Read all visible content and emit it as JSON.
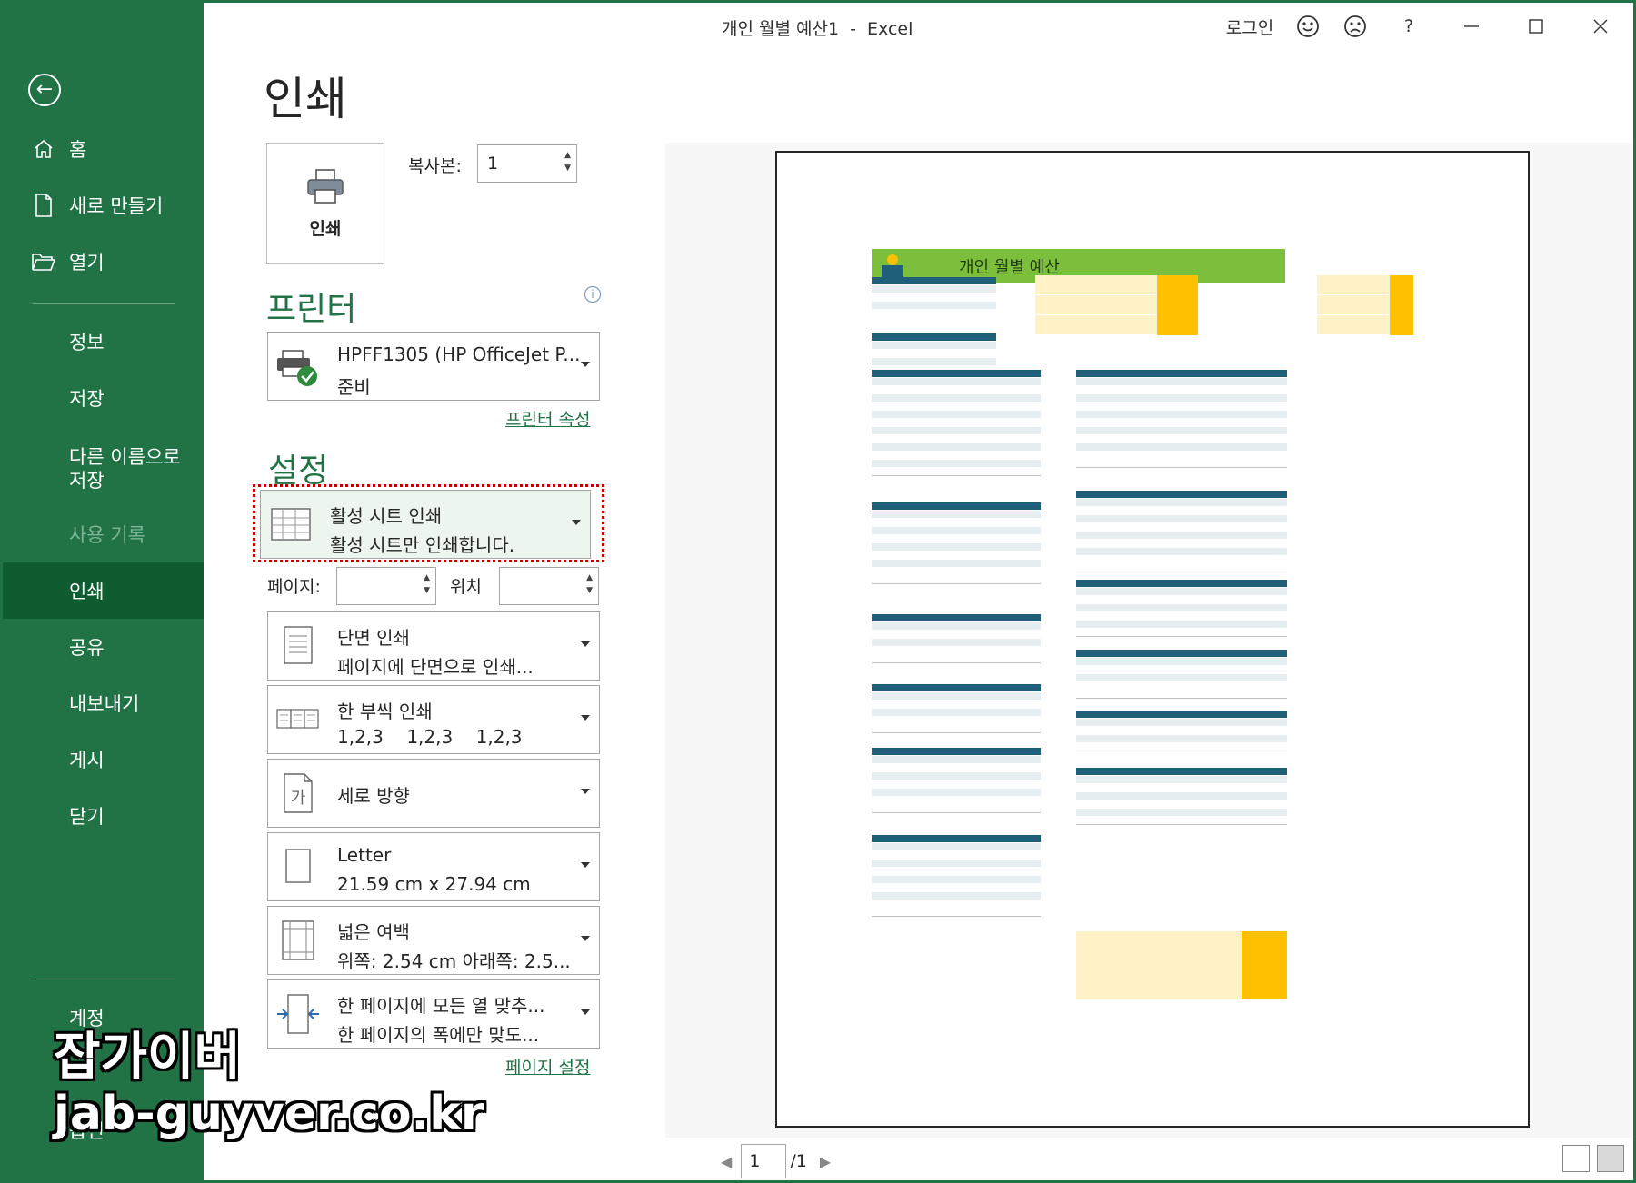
{
  "window": {
    "title": "개인 월별 예산1  -  Excel",
    "signin": "로그인",
    "help": "?"
  },
  "sidebar": {
    "items": [
      {
        "label": "홈"
      },
      {
        "label": "새로 만들기"
      },
      {
        "label": "열기"
      },
      {
        "label": "정보"
      },
      {
        "label": "저장"
      },
      {
        "label": "다른 이름으로\n저장"
      },
      {
        "label": "사용 기록"
      },
      {
        "label": "인쇄"
      },
      {
        "label": "공유"
      },
      {
        "label": "내보내기"
      },
      {
        "label": "게시"
      },
      {
        "label": "닫기"
      },
      {
        "label": "계정"
      },
      {
        "label": "옵션"
      }
    ]
  },
  "main": {
    "title": "인쇄",
    "print_button": "인쇄",
    "copies_label": "복사본:",
    "copies_value": "1",
    "printer_heading": "프린터",
    "printer": {
      "name": "HPFF1305 (HP OfficeJet P...",
      "status": "준비"
    },
    "printer_props_link": "프린터 속성",
    "settings_heading": "설정",
    "settings": [
      {
        "line1": "활성 시트 인쇄",
        "line2": "활성 시트만 인쇄합니다."
      },
      {
        "line1": "단면 인쇄",
        "line2": "페이지에 단면으로 인쇄..."
      },
      {
        "line1": "한 부씩 인쇄",
        "line2": "1,2,3    1,2,3    1,2,3"
      },
      {
        "line1": "세로 방향"
      },
      {
        "line1": "Letter",
        "line2": "21.59 cm x 27.94 cm"
      },
      {
        "line1": "넓은 여백",
        "line2": "위쪽: 2.54 cm 아래쪽: 2.5..."
      },
      {
        "line1": "한 페이지에 모든 열 맞추...",
        "line2": "한 페이지의 폭에만 맞도..."
      }
    ],
    "pages_label": "페이지:",
    "to_label": "위치",
    "page_setup_link": "페이지 설정"
  },
  "preview": {
    "sheet_title": "개인 월별 예산",
    "current_page": "1",
    "total_pages": "/1"
  },
  "watermark": {
    "line1": "잡가이버",
    "line2": "jab-guyver.co.kr"
  },
  "colors": {
    "accent": "#217346",
    "banner": "#7cbf3d",
    "table_header": "#1f5f7a",
    "highlight": "#ffc000",
    "total_bg": "#fff2c6"
  }
}
